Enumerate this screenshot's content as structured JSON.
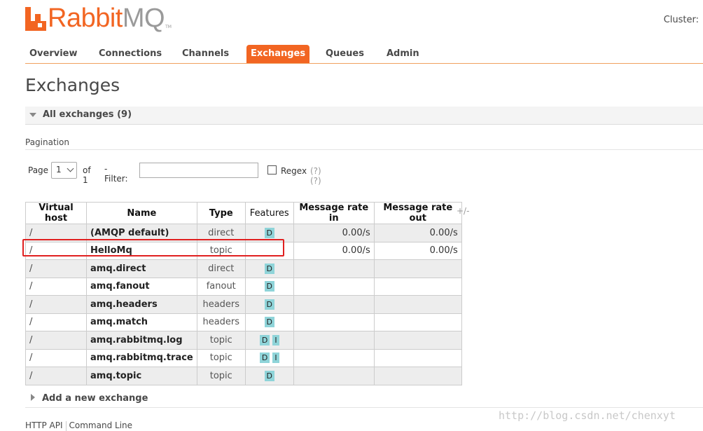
{
  "app": {
    "logo_main": "Rabbit",
    "logo_mq": "MQ",
    "logo_tm": "TM",
    "cluster_label": "Cluster:",
    "brand_color": "#f26522"
  },
  "nav": {
    "items": [
      {
        "label": "Overview"
      },
      {
        "label": "Connections"
      },
      {
        "label": "Channels"
      },
      {
        "label": "Exchanges",
        "active": true
      },
      {
        "label": "Queues"
      },
      {
        "label": "Admin"
      }
    ]
  },
  "page": {
    "title": "Exchanges"
  },
  "section": {
    "title": "All exchanges (9)",
    "icon": "collapse-triangle-icon"
  },
  "pagination": {
    "title": "Pagination",
    "page_label": "Page",
    "page_value": "1",
    "of_label": "of 1",
    "filter_label": "- Filter:",
    "filter_value": "",
    "regex_label": "Regex",
    "regex_help": "(?)(?)"
  },
  "table": {
    "headers": [
      "Virtual host",
      "Name",
      "Type",
      "Features",
      "Message rate in",
      "Message rate out"
    ],
    "toggle_columns": "+/-",
    "rows": [
      {
        "vhost": "/",
        "name": "(AMQP default)",
        "type": "direct",
        "features": [
          "D"
        ],
        "rate_in": "0.00/s",
        "rate_out": "0.00/s"
      },
      {
        "vhost": "/",
        "name": "HelloMq",
        "type": "topic",
        "features": [],
        "rate_in": "0.00/s",
        "rate_out": "0.00/s",
        "highlighted": true
      },
      {
        "vhost": "/",
        "name": "amq.direct",
        "type": "direct",
        "features": [
          "D"
        ],
        "rate_in": "",
        "rate_out": ""
      },
      {
        "vhost": "/",
        "name": "amq.fanout",
        "type": "fanout",
        "features": [
          "D"
        ],
        "rate_in": "",
        "rate_out": ""
      },
      {
        "vhost": "/",
        "name": "amq.headers",
        "type": "headers",
        "features": [
          "D"
        ],
        "rate_in": "",
        "rate_out": ""
      },
      {
        "vhost": "/",
        "name": "amq.match",
        "type": "headers",
        "features": [
          "D"
        ],
        "rate_in": "",
        "rate_out": ""
      },
      {
        "vhost": "/",
        "name": "amq.rabbitmq.log",
        "type": "topic",
        "features": [
          "D",
          "I"
        ],
        "rate_in": "",
        "rate_out": ""
      },
      {
        "vhost": "/",
        "name": "amq.rabbitmq.trace",
        "type": "topic",
        "features": [
          "D",
          "I"
        ],
        "rate_in": "",
        "rate_out": ""
      },
      {
        "vhost": "/",
        "name": "amq.topic",
        "type": "topic",
        "features": [
          "D"
        ],
        "rate_in": "",
        "rate_out": ""
      }
    ]
  },
  "add_exchange": {
    "label": "Add a new exchange",
    "icon": "expand-triangle-icon"
  },
  "footer": {
    "links": [
      "HTTP API",
      "Command Line"
    ]
  },
  "watermark": "http://blog.csdn.net/chenxyt"
}
